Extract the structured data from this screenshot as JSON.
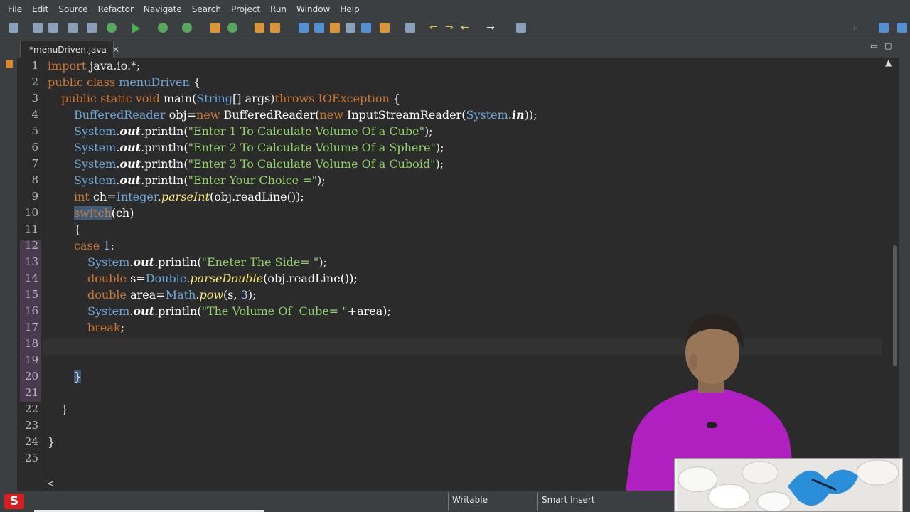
{
  "menu": [
    "File",
    "Edit",
    "Source",
    "Refactor",
    "Navigate",
    "Search",
    "Project",
    "Run",
    "Window",
    "Help"
  ],
  "editor_tab": {
    "title": "*menuDriven.java",
    "close": "✕"
  },
  "window_controls": {
    "minimize": "▭",
    "maximize": "▢"
  },
  "code_lines": [
    {
      "n": "1"
    },
    {
      "n": "2"
    },
    {
      "n": "3"
    },
    {
      "n": "4"
    },
    {
      "n": "5"
    },
    {
      "n": "6"
    },
    {
      "n": "7"
    },
    {
      "n": "8"
    },
    {
      "n": "9"
    },
    {
      "n": "10"
    },
    {
      "n": "11"
    },
    {
      "n": "12"
    },
    {
      "n": "13"
    },
    {
      "n": "14"
    },
    {
      "n": "15"
    },
    {
      "n": "16"
    },
    {
      "n": "17"
    },
    {
      "n": "18"
    },
    {
      "n": "19"
    },
    {
      "n": "20"
    },
    {
      "n": "21"
    },
    {
      "n": "22"
    },
    {
      "n": "23"
    },
    {
      "n": "24"
    },
    {
      "n": "25"
    }
  ],
  "code": {
    "l1": [
      "import",
      " java.io.*;"
    ],
    "l2": [
      "public class",
      " menuDriven",
      " {"
    ],
    "l3": [
      "public static void",
      " main(",
      "String",
      "[] ",
      "args",
      ")",
      "throws",
      " ",
      "IOException",
      " {"
    ],
    "l4": [
      "BufferedReader",
      " obj=",
      "new",
      " BufferedReader(",
      "new",
      " InputStreamReader(",
      "System",
      ".",
      "in",
      "));"
    ],
    "l5": [
      "System",
      ".",
      "out",
      ".println(",
      "\"Enter 1 To Calculate Volume Of a Cube\"",
      ");"
    ],
    "l6": [
      "System",
      ".",
      "out",
      ".println(",
      "\"Enter 2 To Calculate Volume Of a Sphere\"",
      ");"
    ],
    "l7": [
      "System",
      ".",
      "out",
      ".println(",
      "\"Enter 3 To Calculate Volume Of a Cuboid\"",
      ");"
    ],
    "l8": [
      "System",
      ".",
      "out",
      ".println(",
      "\"Enter Your Choice =\"",
      ");"
    ],
    "l9": [
      "int",
      " ch=",
      "Integer",
      ".",
      "parseInt",
      "(obj.readLine());"
    ],
    "l10": [
      "switch",
      "(ch)"
    ],
    "l11": [
      "{"
    ],
    "l12": [
      "case",
      " ",
      "1",
      ":"
    ],
    "l13": [
      "System",
      ".",
      "out",
      ".println(",
      "\"Eneter The Side= \"",
      ");"
    ],
    "l14": [
      "double",
      " s=",
      "Double",
      ".",
      "parseDouble",
      "(obj.readLine());"
    ],
    "l15": [
      "double",
      " area=",
      "Math",
      ".",
      "pow",
      "(s, ",
      "3",
      ");"
    ],
    "l16": [
      "System",
      ".",
      "out",
      ".println(",
      "\"The Volume Of  Cube= \"",
      "+area);"
    ],
    "l17": [
      "break",
      ";"
    ],
    "l20": [
      "}"
    ],
    "l22": [
      "}"
    ],
    "l24": [
      "}"
    ]
  },
  "status": {
    "mode": "Writable",
    "insert": "Smart Insert",
    "logo": "S"
  },
  "scroll": {
    "up": "▲",
    "left": "<"
  },
  "colors": {
    "keyword": "#cc7832",
    "type": "#6fa8dc",
    "string": "#8fd46a",
    "method_italic": "#ffe97a",
    "field": "#ffffff",
    "selection": "#3f5c7a"
  }
}
